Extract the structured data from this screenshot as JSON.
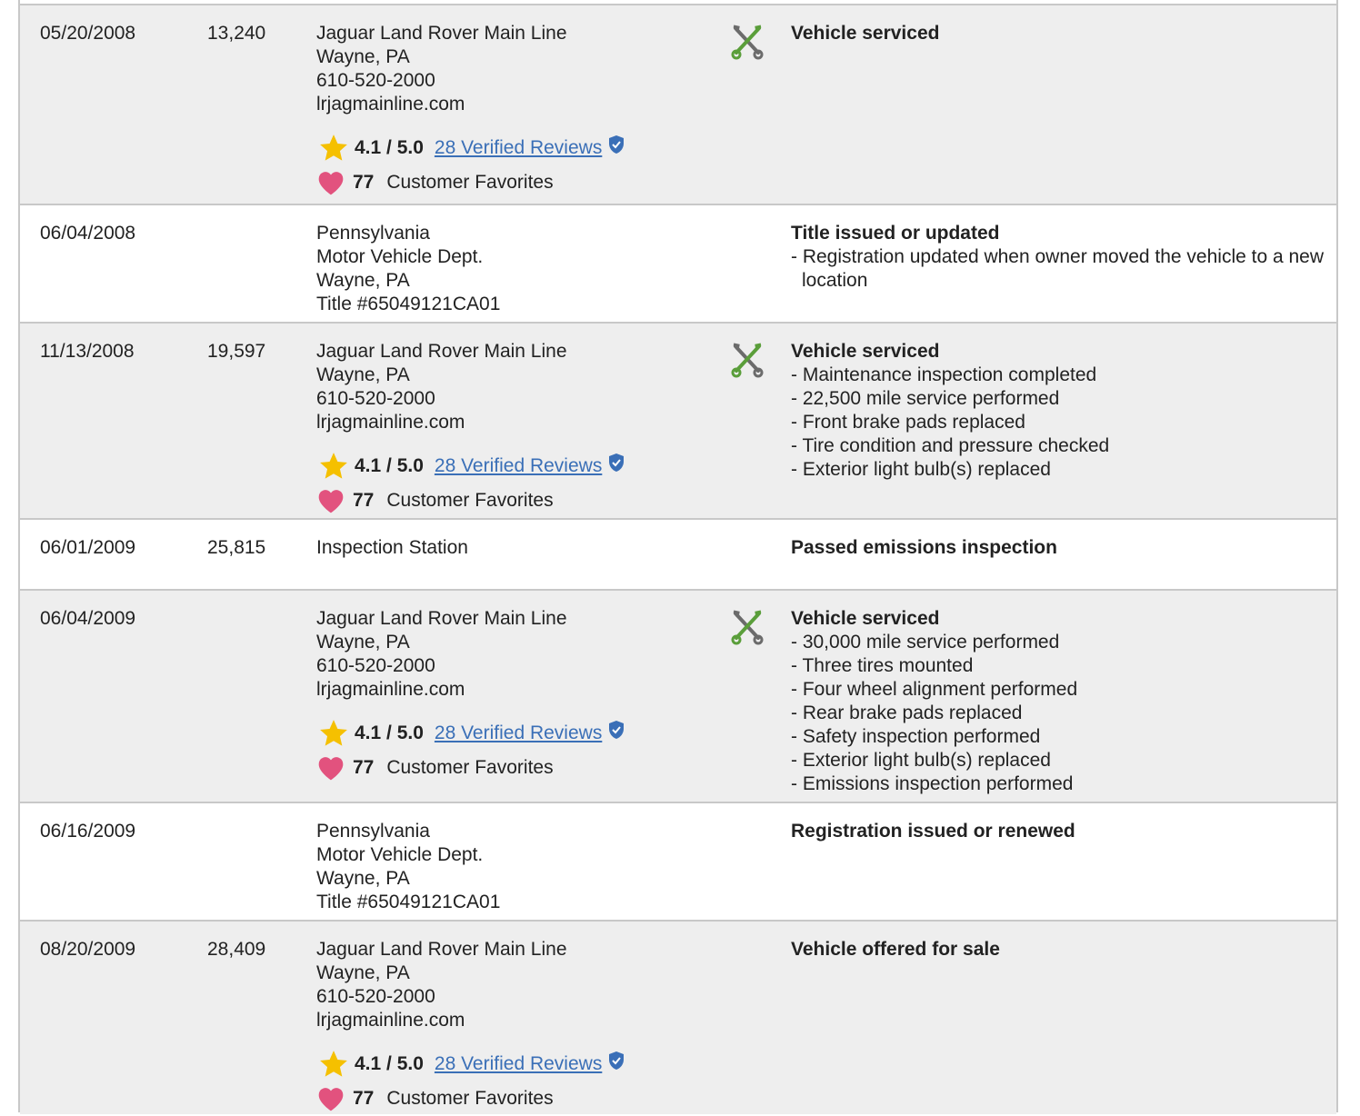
{
  "records": [
    {
      "date": "05/20/2008",
      "mileage": "13,240",
      "source": [
        "Jaguar Land Rover Main Line",
        "Wayne, PA",
        "610-520-2000",
        "lrjagmainline.com"
      ],
      "rating": "4.1 / 5.0",
      "reviews": "28 Verified Reviews",
      "favorites_count": "77",
      "favorites_label": "Customer Favorites",
      "icon": "service-wrench-icon",
      "title": "Vehicle serviced",
      "details": []
    },
    {
      "date": "06/04/2008",
      "mileage": "",
      "source": [
        "Pennsylvania",
        "Motor Vehicle Dept.",
        "Wayne, PA",
        "Title #65049121CA01"
      ],
      "title": "Title issued or updated",
      "details": [
        "- Registration updated when owner moved the vehicle to a new location"
      ]
    },
    {
      "date": "11/13/2008",
      "mileage": "19,597",
      "source": [
        "Jaguar Land Rover Main Line",
        "Wayne, PA",
        "610-520-2000",
        "lrjagmainline.com"
      ],
      "rating": "4.1 / 5.0",
      "reviews": "28 Verified Reviews",
      "favorites_count": "77",
      "favorites_label": "Customer Favorites",
      "icon": "service-wrench-icon",
      "title": "Vehicle serviced",
      "details": [
        "- Maintenance inspection completed",
        "- 22,500 mile service performed",
        "- Front brake pads replaced",
        "- Tire condition and pressure checked",
        "- Exterior light bulb(s) replaced"
      ]
    },
    {
      "date": "06/01/2009",
      "mileage": "25,815",
      "source": [
        "Inspection Station"
      ],
      "title": "Passed emissions inspection",
      "details": []
    },
    {
      "date": "06/04/2009",
      "mileage": "",
      "source": [
        "Jaguar Land Rover Main Line",
        "Wayne, PA",
        "610-520-2000",
        "lrjagmainline.com"
      ],
      "rating": "4.1 / 5.0",
      "reviews": "28 Verified Reviews",
      "favorites_count": "77",
      "favorites_label": "Customer Favorites",
      "icon": "service-wrench-icon",
      "title": "Vehicle serviced",
      "details": [
        "- 30,000 mile service performed",
        "- Three tires mounted",
        "- Four wheel alignment performed",
        "- Rear brake pads replaced",
        "- Safety inspection performed",
        "- Exterior light bulb(s) replaced",
        "- Emissions inspection performed"
      ]
    },
    {
      "date": "06/16/2009",
      "mileage": "",
      "source": [
        "Pennsylvania",
        "Motor Vehicle Dept.",
        "Wayne, PA",
        "Title #65049121CA01"
      ],
      "title": "Registration issued or renewed",
      "details": []
    },
    {
      "date": "08/20/2009",
      "mileage": "28,409",
      "source": [
        "Jaguar Land Rover Main Line",
        "Wayne, PA",
        "610-520-2000",
        "lrjagmainline.com"
      ],
      "rating": "4.1 / 5.0",
      "reviews": "28 Verified Reviews",
      "favorites_count": "77",
      "favorites_label": "Customer Favorites",
      "title": "Vehicle offered for sale",
      "details": []
    }
  ],
  "colors": {
    "shaded_row": "#eeeeee",
    "border": "#c8c8c8",
    "link": "#3a6fb7",
    "star": "#f5c000",
    "heart": "#e2527e",
    "verified": "#3a6fb7"
  }
}
